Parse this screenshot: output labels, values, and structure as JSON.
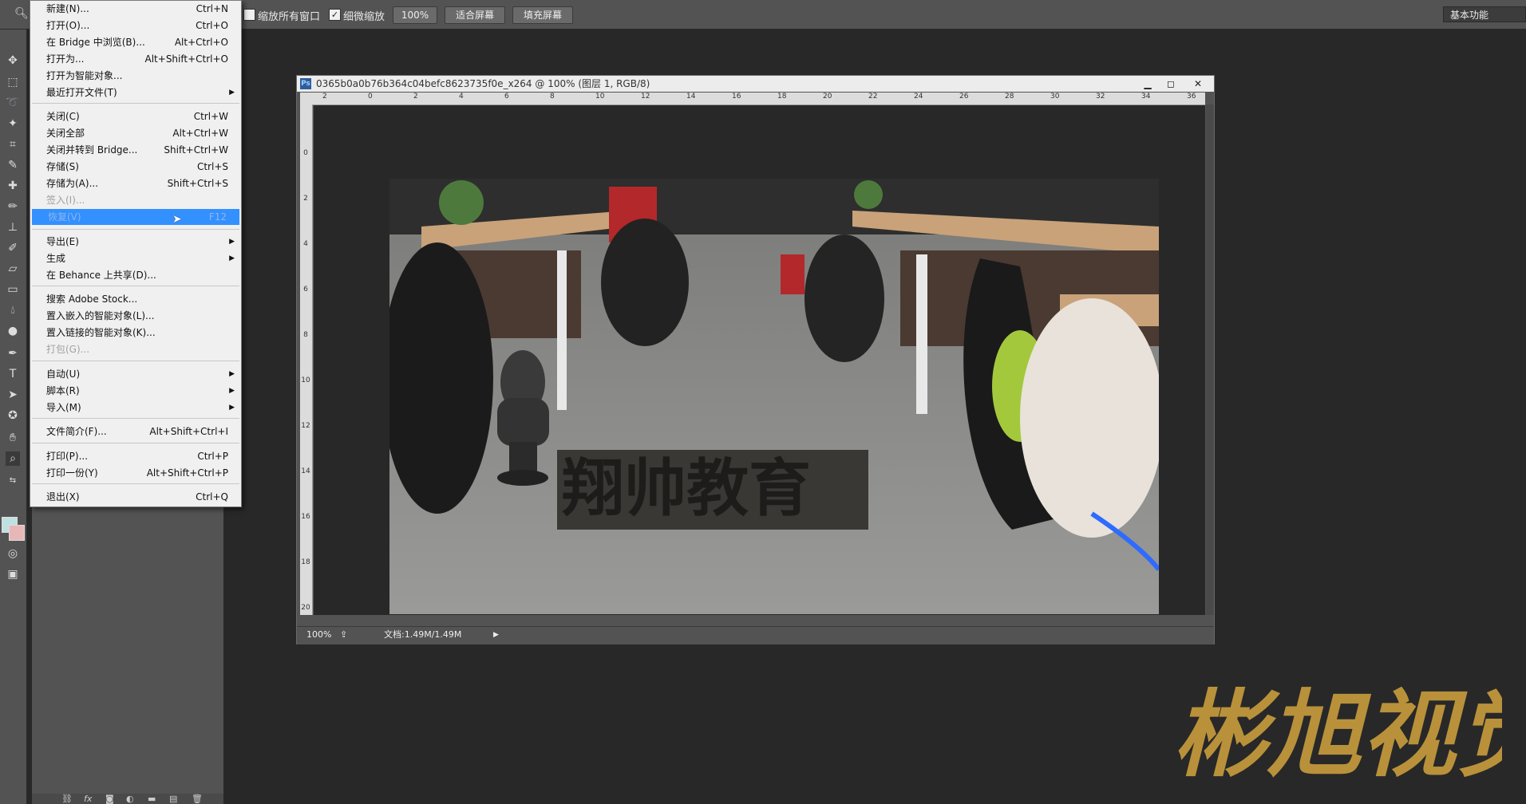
{
  "options_bar": {
    "resize_all_windows_label": "缩放所有窗口",
    "scrubby_zoom_label": "细微缩放",
    "zoom_100_label": "100%",
    "fit_screen_label": "适合屏幕",
    "fill_screen_label": "填充屏幕",
    "workspace_label": "基本功能"
  },
  "file_menu": {
    "items": [
      {
        "label": "新建(N)...",
        "shortcut": "Ctrl+N"
      },
      {
        "label": "打开(O)...",
        "shortcut": "Ctrl+O"
      },
      {
        "label": "在 Bridge 中浏览(B)...",
        "shortcut": "Alt+Ctrl+O"
      },
      {
        "label": "打开为...",
        "shortcut": "Alt+Shift+Ctrl+O"
      },
      {
        "label": "打开为智能对象...",
        "shortcut": ""
      },
      {
        "label": "最近打开文件(T)",
        "shortcut": ""
      },
      {
        "label": "关闭(C)",
        "shortcut": "Ctrl+W"
      },
      {
        "label": "关闭全部",
        "shortcut": "Alt+Ctrl+W"
      },
      {
        "label": "关闭并转到 Bridge...",
        "shortcut": "Shift+Ctrl+W"
      },
      {
        "label": "存储(S)",
        "shortcut": "Ctrl+S"
      },
      {
        "label": "存储为(A)...",
        "shortcut": "Shift+Ctrl+S"
      },
      {
        "label": "签入(I)...",
        "shortcut": ""
      },
      {
        "label": "恢复(V)",
        "shortcut": "F12"
      },
      {
        "label": "导出(E)",
        "shortcut": ""
      },
      {
        "label": "生成",
        "shortcut": ""
      },
      {
        "label": "在 Behance 上共享(D)...",
        "shortcut": ""
      },
      {
        "label": "搜索 Adobe Stock...",
        "shortcut": ""
      },
      {
        "label": "置入嵌入的智能对象(L)...",
        "shortcut": ""
      },
      {
        "label": "置入链接的智能对象(K)...",
        "shortcut": ""
      },
      {
        "label": "打包(G)...",
        "shortcut": ""
      },
      {
        "label": "自动(U)",
        "shortcut": ""
      },
      {
        "label": "脚本(R)",
        "shortcut": ""
      },
      {
        "label": "导入(M)",
        "shortcut": ""
      },
      {
        "label": "文件简介(F)...",
        "shortcut": "Alt+Shift+Ctrl+I"
      },
      {
        "label": "打印(P)...",
        "shortcut": "Ctrl+P"
      },
      {
        "label": "打印一份(Y)",
        "shortcut": "Alt+Shift+Ctrl+P"
      },
      {
        "label": "退出(X)",
        "shortcut": "Ctrl+Q"
      }
    ]
  },
  "document": {
    "title": "0365b0a0b76b364c04befc8623735f0e_x264 @ 100% (图层 1, RGB/8)",
    "ps_badge": "Ps",
    "ruler_h": [
      "2",
      "0",
      "2",
      "4",
      "6",
      "8",
      "10",
      "12",
      "14",
      "16",
      "18",
      "20",
      "22",
      "24",
      "26",
      "28",
      "30",
      "32",
      "34",
      "36"
    ],
    "ruler_v": [
      "0",
      "2",
      "4",
      "6",
      "8",
      "10",
      "12",
      "14",
      "16",
      "18",
      "20"
    ],
    "zoom": "100%",
    "doc_size": "文档:1.49M/1.49M"
  },
  "image": {
    "text_3d": "翔帅教育"
  },
  "watermark": {
    "text": "彬旭视觉"
  },
  "colors": {
    "menu_highlight": "#3390ff",
    "foreground_swatch": "#bfe0e0",
    "background_swatch": "#e7b7b7",
    "watermark_gold": "#b8913a"
  }
}
